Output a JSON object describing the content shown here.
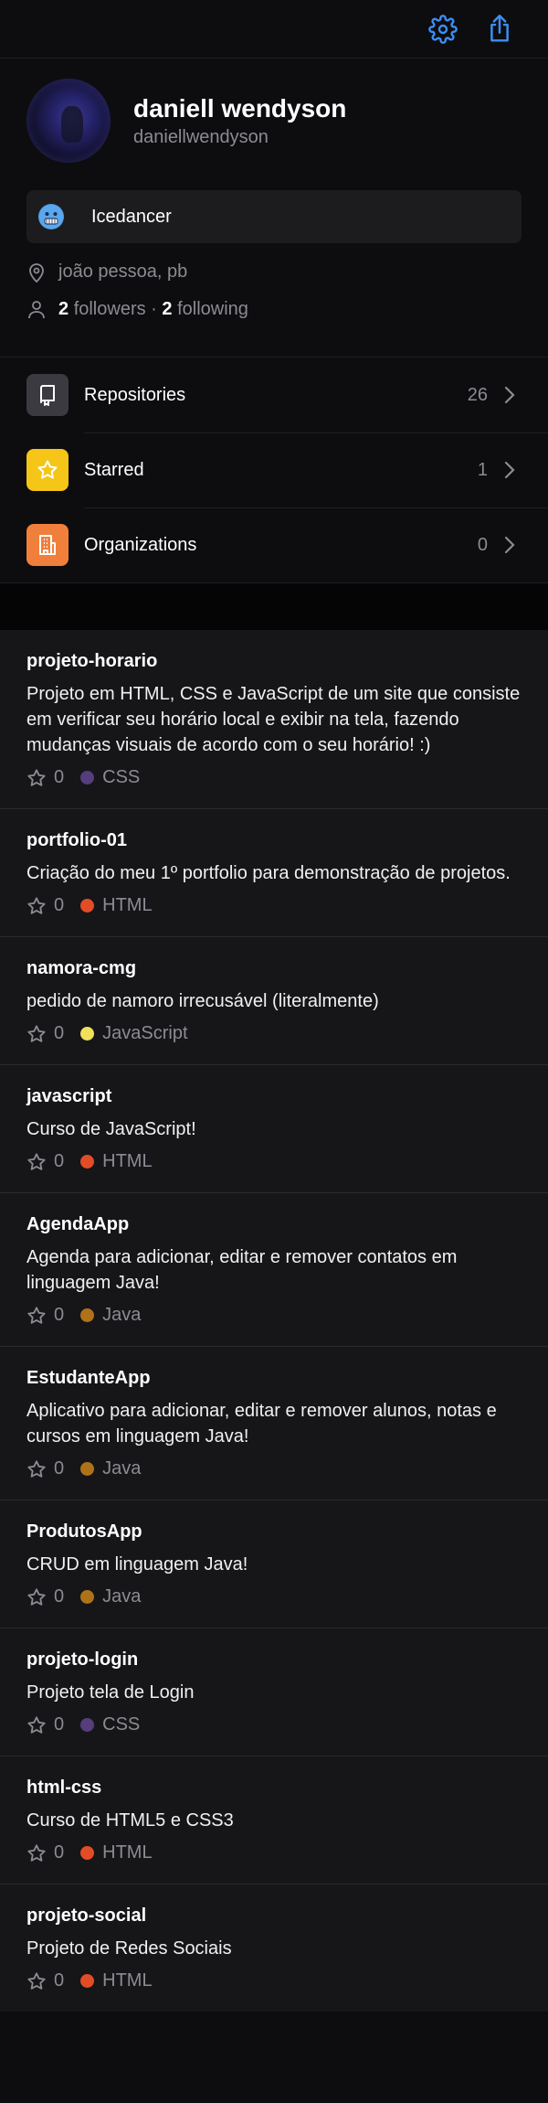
{
  "topbar": {
    "settings_icon": "gear-icon",
    "share_icon": "share-icon",
    "accent": "#3b8ff6"
  },
  "profile": {
    "full_name": "daniell wendyson",
    "login": "daniellwendyson",
    "status_emoji": "cold-face-emoji",
    "status_text": "Icedancer",
    "location": "joão pessoa, pb",
    "followers_count": "2",
    "followers_label": "followers",
    "separator": "·",
    "following_count": "2",
    "following_label": "following"
  },
  "menu": [
    {
      "label": "Repositories",
      "count": "26",
      "icon": "repo-icon",
      "color": "#3a3a40"
    },
    {
      "label": "Starred",
      "count": "1",
      "icon": "star-icon",
      "color": "#f5c518"
    },
    {
      "label": "Organizations",
      "count": "0",
      "icon": "building-icon",
      "color": "#f07f3c"
    }
  ],
  "repos": [
    {
      "name": "projeto-horario",
      "description": "Projeto em HTML, CSS e JavaScript de um site que consiste em verificar seu horário local e exibir na tela, fazendo mudanças visuais de acordo com o seu horário! :)",
      "stars": "0",
      "language": "CSS",
      "lang_color": "#563d7c"
    },
    {
      "name": "portfolio-01",
      "description": "Criação do meu 1º portfolio para demonstração de projetos.",
      "stars": "0",
      "language": "HTML",
      "lang_color": "#e34c26"
    },
    {
      "name": "namora-cmg",
      "description": "pedido de namoro irrecusável (literalmente)",
      "stars": "0",
      "language": "JavaScript",
      "lang_color": "#f1e05a"
    },
    {
      "name": "javascript",
      "description": "Curso de JavaScript!",
      "stars": "0",
      "language": "HTML",
      "lang_color": "#e34c26"
    },
    {
      "name": "AgendaApp",
      "description": "Agenda para adicionar, editar e remover contatos em linguagem Java!",
      "stars": "0",
      "language": "Java",
      "lang_color": "#b07219"
    },
    {
      "name": "EstudanteApp",
      "description": "Aplicativo para adicionar, editar e remover alunos, notas e cursos em linguagem Java!",
      "stars": "0",
      "language": "Java",
      "lang_color": "#b07219"
    },
    {
      "name": "ProdutosApp",
      "description": "CRUD em linguagem Java!",
      "stars": "0",
      "language": "Java",
      "lang_color": "#b07219"
    },
    {
      "name": "projeto-login",
      "description": "Projeto tela de Login",
      "stars": "0",
      "language": "CSS",
      "lang_color": "#563d7c"
    },
    {
      "name": "html-css",
      "description": "Curso de HTML5 e CSS3",
      "stars": "0",
      "language": "HTML",
      "lang_color": "#e34c26"
    },
    {
      "name": "projeto-social",
      "description": "Projeto de Redes Sociais",
      "stars": "0",
      "language": "HTML",
      "lang_color": "#e34c26"
    }
  ]
}
